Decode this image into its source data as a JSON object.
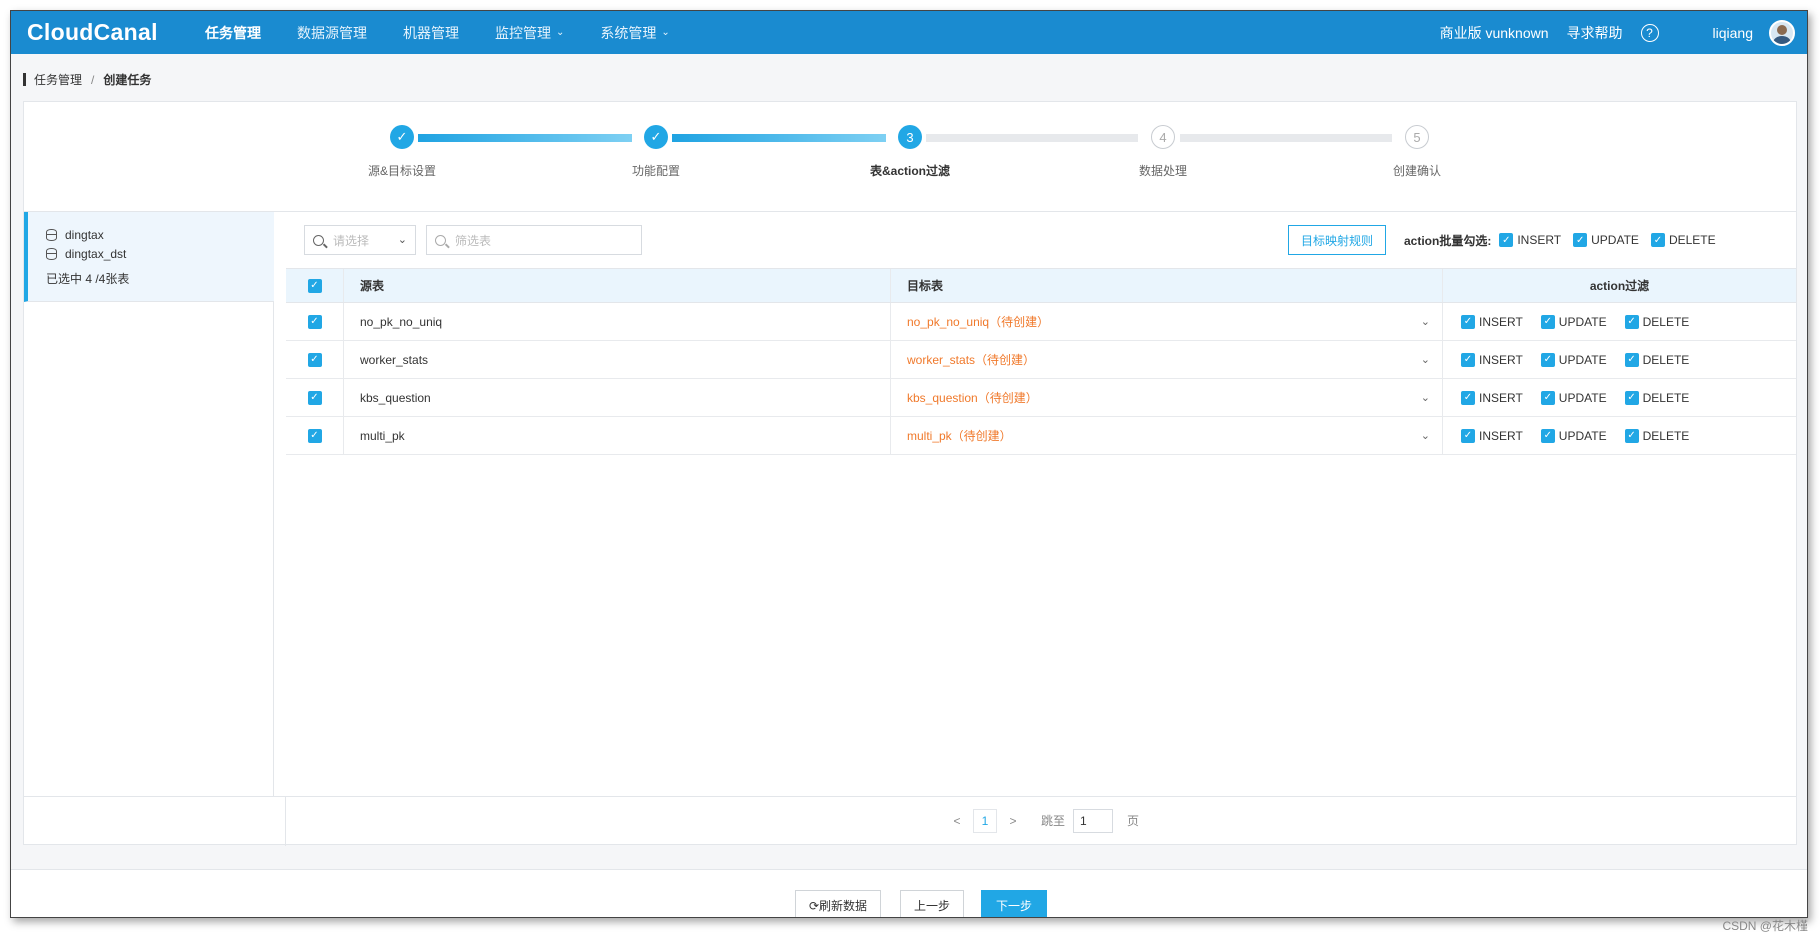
{
  "app": {
    "logo": "CloudCanal"
  },
  "nav": {
    "items": [
      {
        "label": "任务管理"
      },
      {
        "label": "数据源管理"
      },
      {
        "label": "机器管理"
      },
      {
        "label": "监控管理"
      },
      {
        "label": "系统管理"
      }
    ],
    "caret": "⌄"
  },
  "topright": {
    "edition": "商业版 vunknown",
    "help": "寻求帮助",
    "help_icon": "?",
    "user": "liqiang"
  },
  "breadcrumb": {
    "parent": "任务管理",
    "separator": "/",
    "current": "创建任务"
  },
  "steps": [
    {
      "label": "源&目标设置",
      "status": "done",
      "symbol": "✓"
    },
    {
      "label": "功能配置",
      "status": "done",
      "symbol": "✓"
    },
    {
      "label": "表&action过滤",
      "status": "current",
      "symbol": "3"
    },
    {
      "label": "数据处理",
      "status": "todo",
      "symbol": "4"
    },
    {
      "label": "创建确认",
      "status": "todo",
      "symbol": "5"
    }
  ],
  "left": {
    "databases": [
      "dingtax",
      "dingtax_dst"
    ],
    "selected_count": "已选中 4 /4张表"
  },
  "toolbar": {
    "select_placeholder": "请选择",
    "filter_placeholder": "筛选表",
    "map_button": "目标映射规则",
    "batch_label": "action批量勾选:",
    "batch_actions": [
      "INSERT",
      "UPDATE",
      "DELETE"
    ]
  },
  "table": {
    "headers": {
      "source": "源表",
      "target": "目标表",
      "action": "action过滤"
    },
    "rows": [
      {
        "source": "no_pk_no_uniq",
        "target": "no_pk_no_uniq（待创建）"
      },
      {
        "source": "worker_stats",
        "target": "worker_stats（待创建）"
      },
      {
        "source": "kbs_question",
        "target": "kbs_question（待创建）"
      },
      {
        "source": "multi_pk",
        "target": "multi_pk（待创建）"
      }
    ],
    "actions": [
      "INSERT",
      "UPDATE",
      "DELETE"
    ],
    "check_mark": "✓"
  },
  "pager": {
    "prev": "<",
    "page": "1",
    "next": ">",
    "jump_label": "跳至",
    "jump_value": "1",
    "page_word": "页"
  },
  "buttons": {
    "refresh": "⟳刷新数据",
    "prev": "上一步",
    "next": "下一步"
  },
  "watermark": "CSDN @花木槿",
  "colors": {
    "primary": "#21a7e5",
    "nav": "#1a8bd0",
    "target_text": "#f0792b"
  }
}
